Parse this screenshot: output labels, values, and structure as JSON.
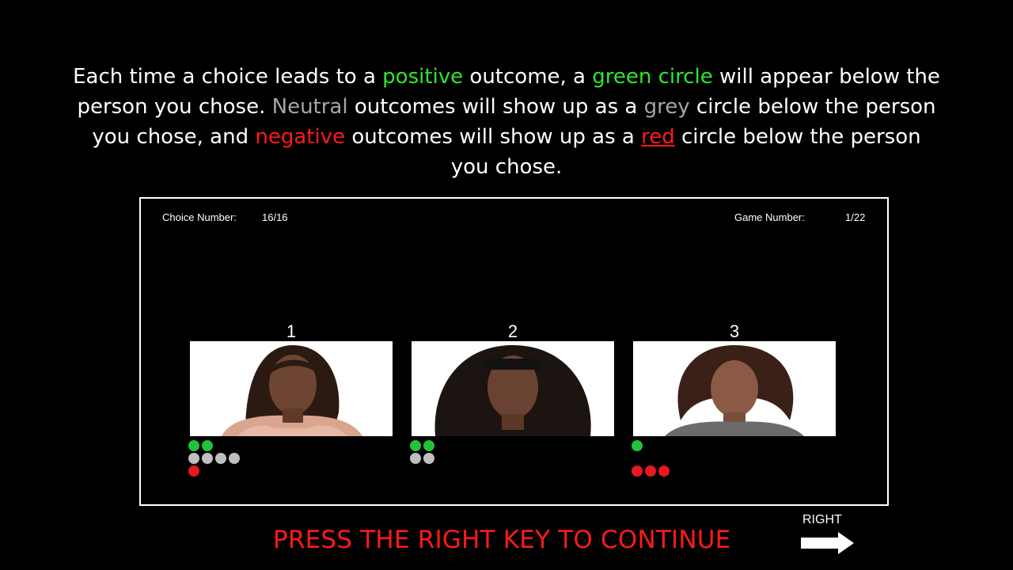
{
  "instructions": {
    "p1": "Each time a choice leads to a ",
    "positive": "positive",
    "p2": " outcome, a ",
    "green_circle": "green circle",
    "p3": " will appear below the person you chose. ",
    "neutral": "Neutral",
    "p4": " outcomes will show up as a ",
    "grey": "grey",
    "p5": " circle below the person you chose, and ",
    "negative": "negative",
    "p6": " outcomes will show up as a ",
    "red": "red",
    "p7": " circle below the person you chose."
  },
  "hud": {
    "choice_label": "Choice Number:",
    "choice_value": "16/16",
    "game_label": "Game Number:",
    "game_value": "1/22"
  },
  "persons": [
    {
      "number": "1",
      "positive": 2,
      "neutral": 4,
      "negative": 1
    },
    {
      "number": "2",
      "positive": 2,
      "neutral": 2,
      "negative": 0
    },
    {
      "number": "3",
      "positive": 1,
      "neutral": 0,
      "negative": 3
    }
  ],
  "footer": {
    "press_text": "PRESS THE RIGHT KEY TO CONTINUE",
    "right_label": "RIGHT"
  },
  "colors": {
    "positive": "#22c33a",
    "neutral": "#bfbfbf",
    "negative": "#e8181e",
    "prompt": "#ff1a1a"
  }
}
